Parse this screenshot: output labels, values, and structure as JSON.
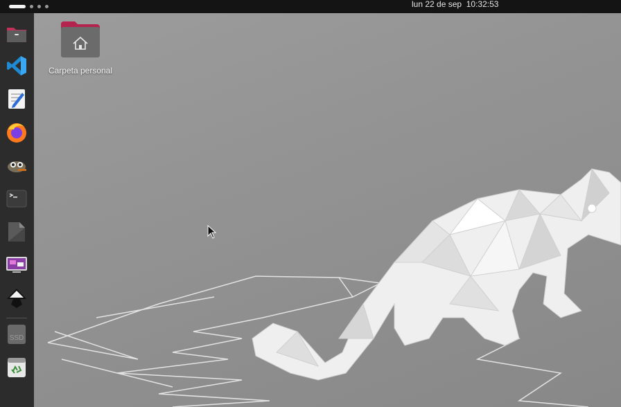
{
  "topbar": {
    "clock": "lun 22 de sep  10:32:53"
  },
  "dock": {
    "items": [
      {
        "name": "files",
        "icon": "folder-icon"
      },
      {
        "name": "vscode",
        "icon": "vscode-icon"
      },
      {
        "name": "text-editor",
        "icon": "text-editor-icon"
      },
      {
        "name": "firefox",
        "icon": "firefox-icon"
      },
      {
        "name": "gimp",
        "icon": "gimp-icon"
      },
      {
        "name": "terminal",
        "icon": "terminal-icon"
      },
      {
        "name": "libreoffice",
        "icon": "document-icon"
      },
      {
        "name": "remote-desktop",
        "icon": "remote-desktop-icon"
      },
      {
        "name": "inkscape",
        "icon": "inkscape-icon"
      },
      {
        "name": "ssd",
        "label": "SSD",
        "icon": "drive-icon"
      },
      {
        "name": "trash",
        "icon": "trash-icon"
      }
    ]
  },
  "desktop": {
    "home_icon_label": "Carpeta personal"
  },
  "colors": {
    "topbar": "#141414",
    "dock": "#2c2c2c",
    "desktop": "#939393",
    "home_folder": "#b3234d"
  }
}
